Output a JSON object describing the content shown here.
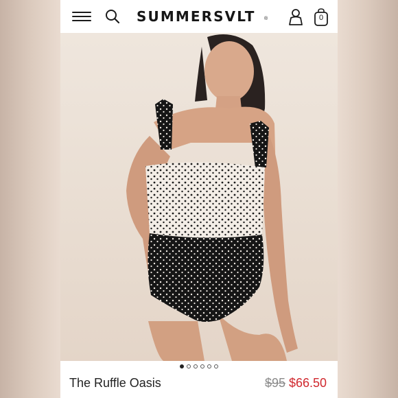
{
  "header": {
    "menu_icon": "hamburger-menu-icon",
    "search_icon": "search-icon",
    "brand": "SUMMERSVLT",
    "registered_mark": "®",
    "account_icon": "user-icon",
    "bag_icon": "shopping-bag-icon",
    "bag_count": "0"
  },
  "gallery": {
    "image_count": 6,
    "active_index": 0
  },
  "product": {
    "name": "The Ruffle Oasis",
    "original_price": "$95",
    "sale_price": "$66.50"
  },
  "colors": {
    "sale": "#d0272d",
    "text": "#222222",
    "muted": "#8a8a8a"
  }
}
